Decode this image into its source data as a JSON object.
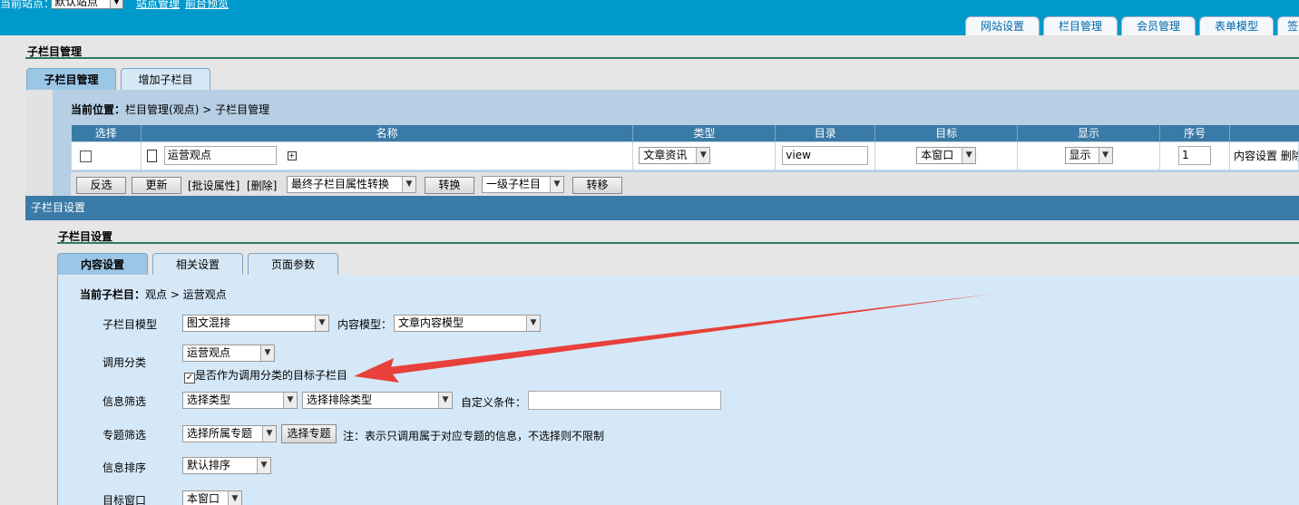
{
  "topbar": {
    "site_label": "当前站点：",
    "site_value": "默认站点",
    "links": [
      "站点管理",
      "前台预览"
    ],
    "tabs": [
      "网站设置",
      "栏目管理",
      "会员管理",
      "表单模型",
      "签"
    ]
  },
  "section1": {
    "title": "子栏目管理",
    "tabs": [
      "子栏目管理",
      "增加子栏目"
    ],
    "location_label": "当前位置：",
    "location_value": "栏目管理(观点) > 子栏目管理",
    "table": {
      "headers": [
        "选择",
        "名称",
        "类型",
        "目录",
        "目标",
        "显示",
        "序号"
      ],
      "row": {
        "name": "运营观点",
        "type": "文章资讯",
        "dir": "view",
        "target": "本窗口",
        "display": "显示",
        "order": "1",
        "ops": "内容设置 删除"
      }
    },
    "actions": {
      "invert": "反选",
      "update": "更新",
      "batch": "[批设属性]",
      "delete": "[删除]",
      "convert_select": "最终子栏目属性转换",
      "convert_btn": "转换",
      "move_select": "一级子栏目",
      "move_btn": "转移"
    }
  },
  "section2": {
    "bar": "子栏目设置",
    "title": "子栏目设置",
    "tabs": [
      "内容设置",
      "相关设置",
      "页面参数"
    ],
    "current_label": "当前子栏目：",
    "current_value": "观点 > 运营观点",
    "fields": {
      "model_label": "子栏目模型",
      "model_value": "图文混排",
      "content_model_label": "内容模型：",
      "content_model_value": "文章内容模型",
      "call_label": "调用分类",
      "call_value": "运营观点",
      "call_checkbox": "是否作为调用分类的目标子栏目",
      "filter_label": "信息筛选",
      "filter_type": "选择类型",
      "filter_exclude": "选择排除类型",
      "custom_label": "自定义条件：",
      "topic_label": "专题筛选",
      "topic_select": "选择所属专题",
      "topic_btn": "选择专题",
      "topic_note": "注：表示只调用属于对应专题的信息，不选择则不限制",
      "sort_label": "信息排序",
      "sort_value": "默认排序",
      "window_label": "目标窗口",
      "window_value": "本窗口"
    }
  },
  "colors": {
    "topbar": "#0099cc",
    "header": "#3a7aa6",
    "panel": "#d5e8f7",
    "arrow": "#e8403a"
  }
}
